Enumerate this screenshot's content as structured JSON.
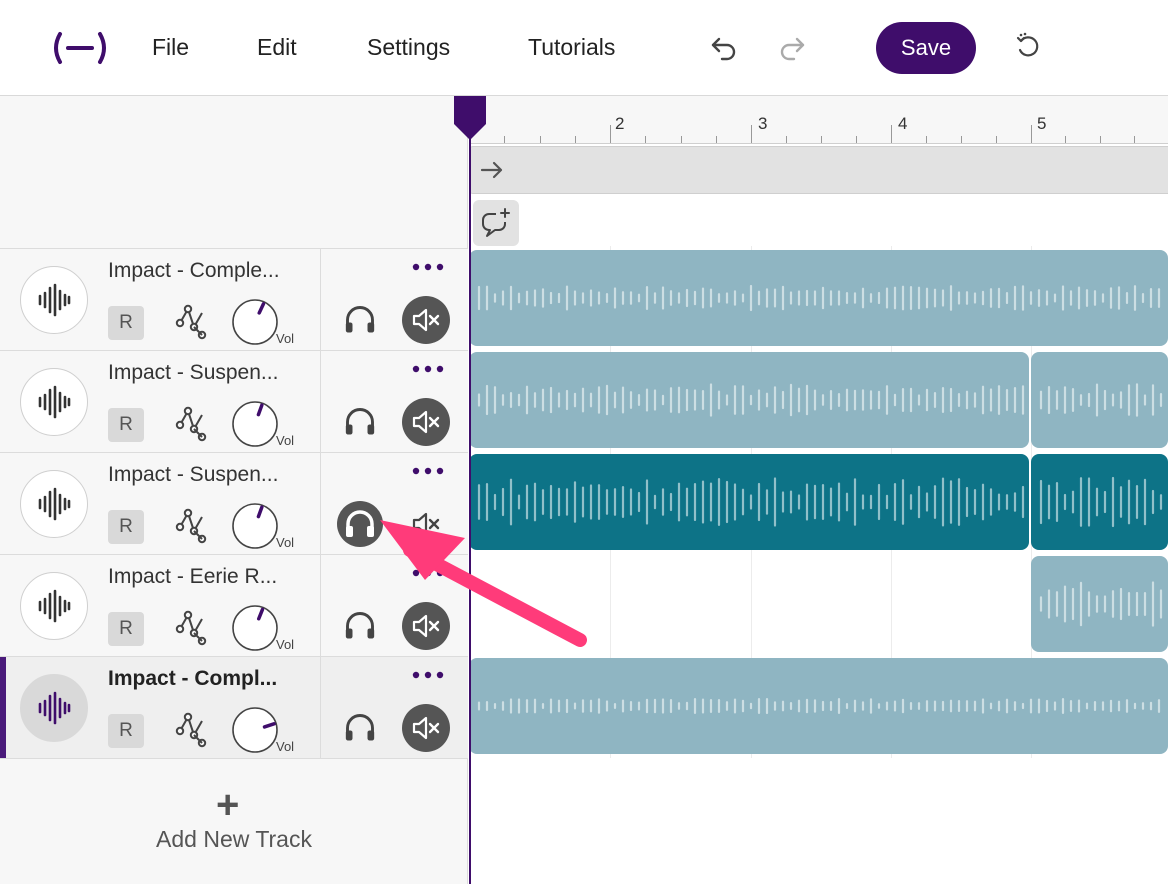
{
  "menu": {
    "file": "File",
    "edit": "Edit",
    "settings": "Settings",
    "tutorials": "Tutorials"
  },
  "toolbar": {
    "save_label": "Save"
  },
  "ruler": {
    "bars": [
      "2",
      "3",
      "4",
      "5"
    ]
  },
  "tracks": [
    {
      "name": "Impact - Comple...",
      "record": "R",
      "vol_label": "Vol",
      "solo": false,
      "mute": true,
      "selected": false
    },
    {
      "name": "Impact - Suspen...",
      "record": "R",
      "vol_label": "Vol",
      "solo": false,
      "mute": true,
      "selected": false
    },
    {
      "name": "Impact - Suspen...",
      "record": "R",
      "vol_label": "Vol",
      "solo": true,
      "mute": false,
      "selected": false
    },
    {
      "name": "Impact - Eerie R...",
      "record": "R",
      "vol_label": "Vol",
      "solo": false,
      "mute": true,
      "selected": false
    },
    {
      "name": "Impact - Compl...",
      "record": "R",
      "vol_label": "Vol",
      "solo": false,
      "mute": true,
      "selected": true
    }
  ],
  "add_track": {
    "label": "Add New Track"
  },
  "colors": {
    "brand": "#3f0d6b",
    "clip": "#8fb5c2",
    "clip_active": "#0d7387",
    "annotation": "#ff3b7a"
  }
}
